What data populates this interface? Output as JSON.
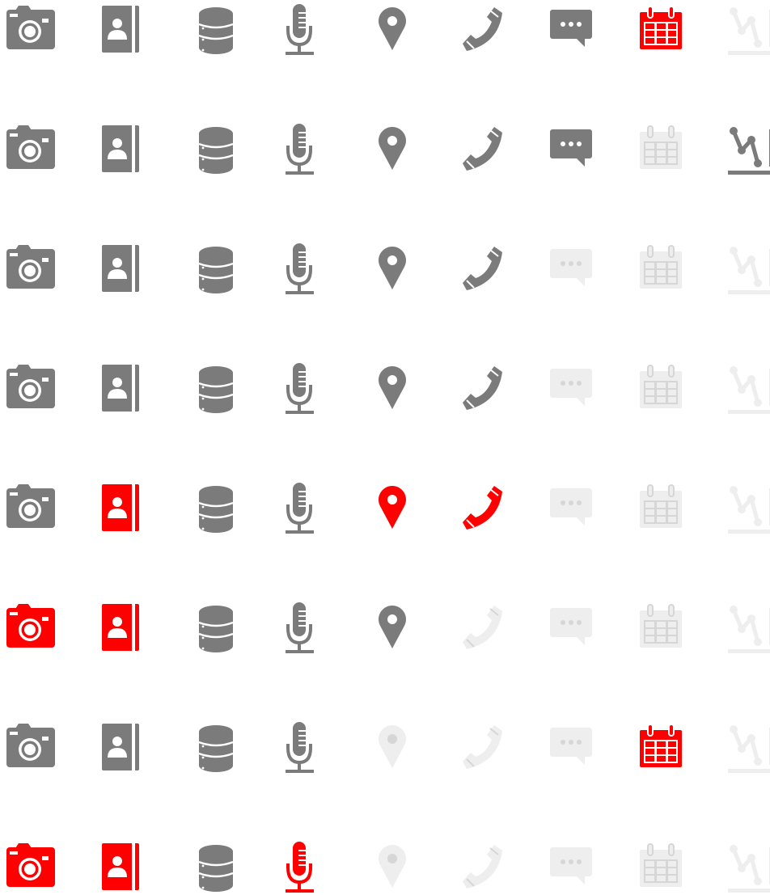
{
  "colors": {
    "gray": "#7b7b7b",
    "red": "#ff0000",
    "faded": "#eeeeee",
    "cutout_on_light": "#ffffff",
    "cutout_on_faded": "#d6d6d6"
  },
  "icon_columns": [
    "camera-icon",
    "contact-book-icon",
    "database-icon",
    "microphone-icon",
    "location-pin-icon",
    "phone-icon",
    "chat-bubble-icon",
    "calendar-icon",
    "chart-icon"
  ],
  "rows": [
    [
      "gray",
      "gray",
      "gray",
      "gray",
      "gray",
      "gray",
      "gray",
      "red",
      "faded"
    ],
    [
      "gray",
      "gray",
      "gray",
      "gray",
      "gray",
      "gray",
      "gray",
      "faded",
      "gray"
    ],
    [
      "gray",
      "gray",
      "gray",
      "gray",
      "gray",
      "gray",
      "faded",
      "faded",
      "faded"
    ],
    [
      "gray",
      "gray",
      "gray",
      "gray",
      "gray",
      "gray",
      "faded",
      "faded",
      "faded"
    ],
    [
      "gray",
      "red",
      "gray",
      "gray",
      "red",
      "red",
      "faded",
      "faded",
      "faded"
    ],
    [
      "red",
      "red",
      "gray",
      "gray",
      "gray",
      "faded",
      "faded",
      "faded",
      "faded"
    ],
    [
      "gray",
      "gray",
      "gray",
      "gray",
      "faded",
      "faded",
      "faded",
      "red",
      "faded"
    ],
    [
      "red",
      "red",
      "gray",
      "red",
      "faded",
      "faded",
      "faded",
      "faded",
      "faded"
    ]
  ]
}
